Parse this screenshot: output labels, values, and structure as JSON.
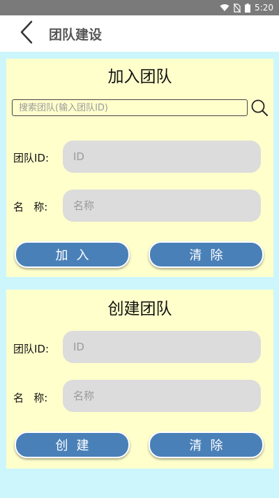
{
  "status_bar": {
    "time": "5:20",
    "icons": [
      "wifi-icon",
      "no-sim-icon",
      "battery-icon"
    ]
  },
  "header": {
    "title": "团队建设",
    "back_icon": "chevron-left-icon"
  },
  "join_panel": {
    "title": "加入团队",
    "search_placeholder": "搜索团队(输入团队ID)",
    "team_id_label": "团队ID:",
    "team_id_placeholder": "ID",
    "name_label": "名   称:",
    "name_placeholder": "名称",
    "join_button": "加入",
    "clear_button": "清除"
  },
  "create_panel": {
    "title": "创建团队",
    "team_id_label": "团队ID:",
    "team_id_placeholder": "ID",
    "name_label": "名   称:",
    "name_placeholder": "名称",
    "create_button": "创建",
    "clear_button": "清除"
  },
  "colors": {
    "background": "#ccf6fb",
    "panel": "#ffffcc",
    "button": "#4a80b8",
    "input": "#dcdcdc",
    "status_bar": "#7a7a7a"
  }
}
